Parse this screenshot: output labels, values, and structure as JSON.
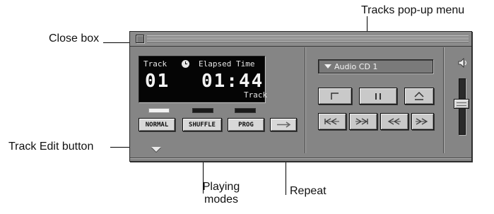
{
  "callouts": {
    "tracks_popup_menu": "Tracks pop-up menu",
    "close_box": "Close box",
    "track_edit_button": "Track Edit button",
    "playing_modes": "Playing modes",
    "repeat": "Repeat"
  },
  "display": {
    "track_label": "Track",
    "elapsed_label": "Elapsed Time",
    "track_number": "01",
    "time": "01:44",
    "time_mode": "Track",
    "clock_icon": "clock-icon"
  },
  "modes": {
    "normal": "NORMAL",
    "shuffle": "SHUFFLE",
    "prog": "PROG",
    "active_indicator": "normal"
  },
  "tracks_popup": {
    "value": "Audio CD 1"
  },
  "controls": {
    "icons": [
      "stop-icon",
      "pause-icon",
      "eject-icon",
      "previous-track-icon",
      "next-track-icon",
      "rewind-icon",
      "fast-forward-icon",
      "repeat-arrow-icon",
      "speaker-icon",
      "popup-triangle-icon",
      "disclosure-triangle-icon"
    ]
  },
  "volume": {
    "level": 0.55
  },
  "colors": {
    "window_gray": "#858585",
    "lcd_background": "#050505",
    "lcd_text": "#f4f4f4",
    "button_face": "#d8d8d8"
  }
}
